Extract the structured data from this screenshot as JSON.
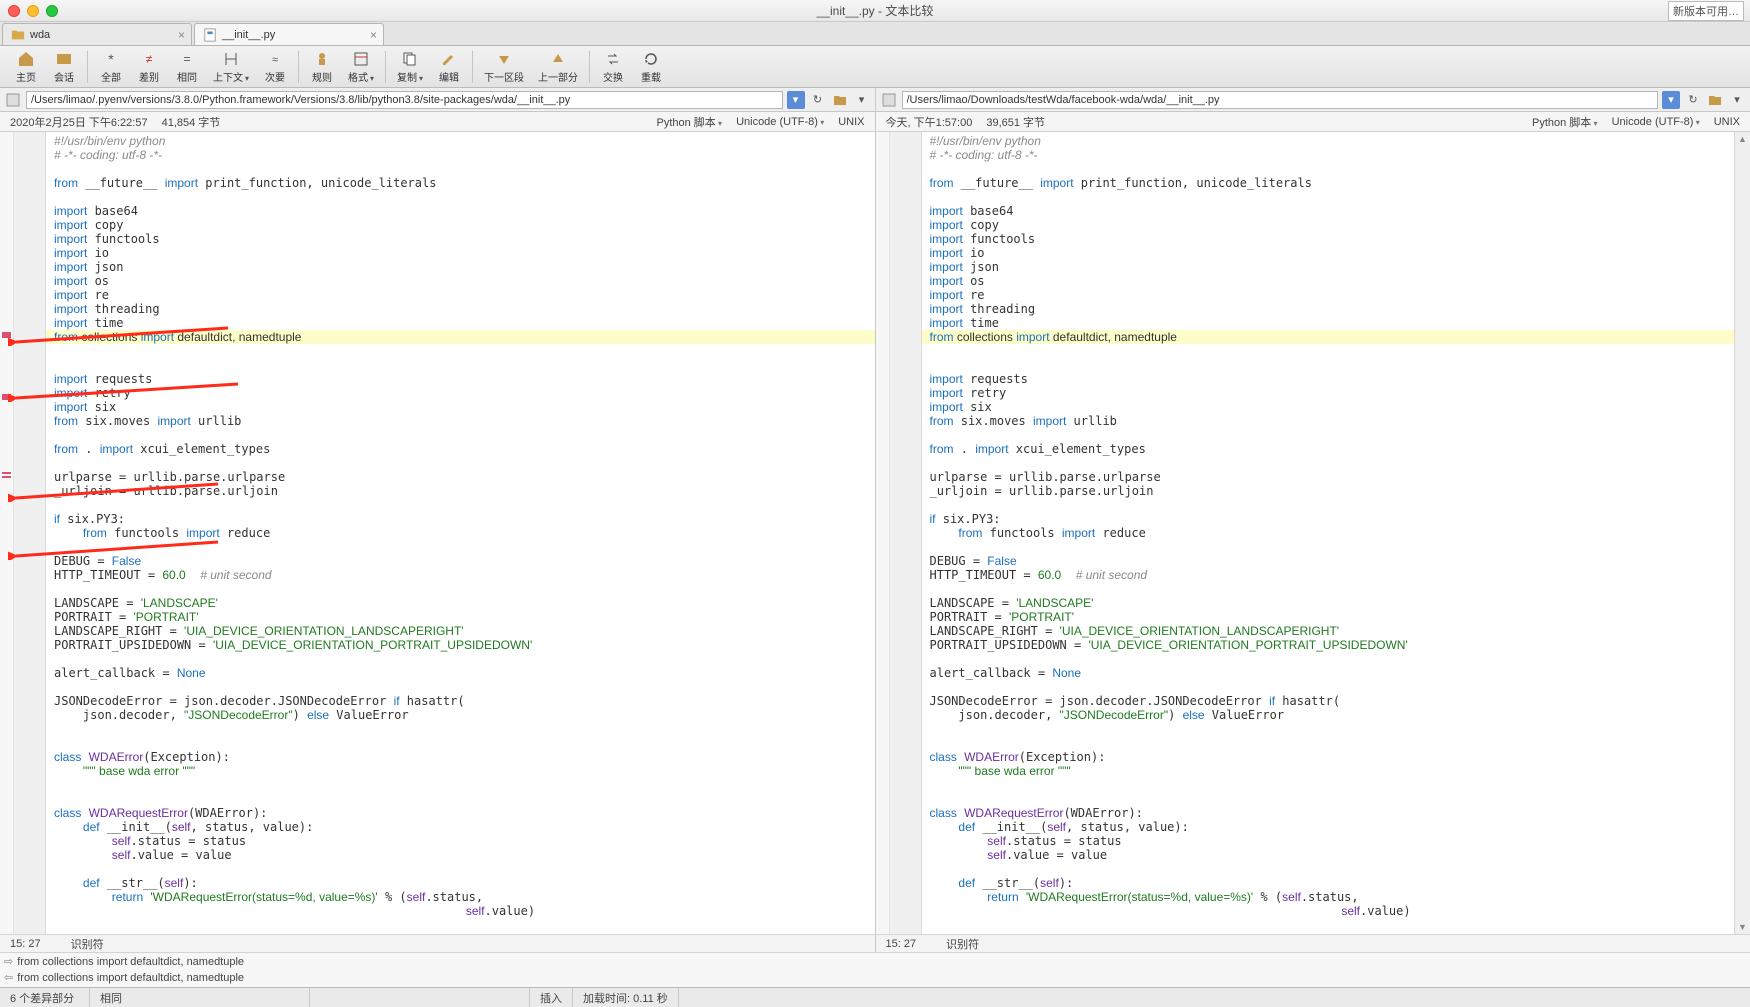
{
  "title": "__init__.py - 文本比较",
  "update_notice": "新版本可用…",
  "tabs": [
    {
      "label": "wda",
      "active": false
    },
    {
      "label": "__init__.py",
      "active": true
    }
  ],
  "toolbar": [
    {
      "id": "home",
      "label": "主页"
    },
    {
      "id": "session",
      "label": "会话"
    },
    {
      "id": "all",
      "label": "全部"
    },
    {
      "id": "diff",
      "label": "差别"
    },
    {
      "id": "same",
      "label": "相同"
    },
    {
      "id": "context",
      "label": "上下文"
    },
    {
      "id": "next",
      "label": "次要"
    },
    {
      "id": "rules",
      "label": "规则"
    },
    {
      "id": "format",
      "label": "格式"
    },
    {
      "id": "copy",
      "label": "复制"
    },
    {
      "id": "edit",
      "label": "编辑"
    },
    {
      "id": "next-diff",
      "label": "下一区段"
    },
    {
      "id": "prev-diff",
      "label": "上一部分"
    },
    {
      "id": "swap",
      "label": "交换"
    },
    {
      "id": "reload",
      "label": "重载"
    }
  ],
  "left": {
    "path": "/Users/limao/.pyenv/versions/3.8.0/Python.framework/Versions/3.8/lib/python3.8/site-packages/wda/__init__.py",
    "meta": {
      "date": "2020年2月25日  下午6:22:57",
      "size": "41,854 字节",
      "lang": "Python 脚本",
      "enc": "Unicode (UTF-8)",
      "eol": "UNIX"
    },
    "cursor": {
      "pos": "15: 27",
      "token": "识别符"
    }
  },
  "right": {
    "path": "/Users/limao/Downloads/testWda/facebook-wda/wda/__init__.py",
    "meta": {
      "date": "今天, 下午1:57:00",
      "size": "39,651 字节",
      "lang": "Python 脚本",
      "enc": "Unicode (UTF-8)",
      "eol": "UNIX"
    },
    "cursor": {
      "pos": "15: 27",
      "token": "识别符"
    }
  },
  "diff_summary": {
    "line_a": "from collections import defaultdict, namedtuple",
    "line_b": "from collections import defaultdict, namedtuple"
  },
  "status": {
    "diff_count": "6 个差异部分",
    "mode": "相同",
    "insert": "插入",
    "load": "加载时间: 0.11 秒"
  },
  "code": {
    "lines": [
      {
        "t": "#!/usr/bin/env python",
        "cls": "c-cm"
      },
      {
        "t": "# -*- coding: utf-8 -*-",
        "cls": "c-cm"
      },
      {
        "t": ""
      },
      {
        "t": "from __future__ import print_function, unicode_literals",
        "kw": [
          "from",
          "import"
        ]
      },
      {
        "t": ""
      },
      {
        "t": "import base64",
        "kw": [
          "import"
        ]
      },
      {
        "t": "import copy",
        "kw": [
          "import"
        ]
      },
      {
        "t": "import functools",
        "kw": [
          "import"
        ]
      },
      {
        "t": "import io",
        "kw": [
          "import"
        ]
      },
      {
        "t": "import json",
        "kw": [
          "import"
        ]
      },
      {
        "t": "import os",
        "kw": [
          "import"
        ]
      },
      {
        "t": "import re",
        "kw": [
          "import"
        ]
      },
      {
        "t": "import threading",
        "kw": [
          "import"
        ]
      },
      {
        "t": "import time",
        "kw": [
          "import"
        ]
      },
      {
        "t": "from collections import defaultdict, namedtuple",
        "kw": [
          "from",
          "import"
        ],
        "hl": true
      },
      {
        "t": ""
      },
      {
        "t": "import requests",
        "kw": [
          "import"
        ]
      },
      {
        "t": "import retry",
        "kw": [
          "import"
        ]
      },
      {
        "t": "import six",
        "kw": [
          "import"
        ]
      },
      {
        "t": "from six.moves import urllib",
        "kw": [
          "from",
          "import"
        ]
      },
      {
        "t": ""
      },
      {
        "t": "from . import xcui_element_types",
        "kw": [
          "from",
          "import"
        ]
      },
      {
        "t": ""
      },
      {
        "t": "urlparse = urllib.parse.urlparse"
      },
      {
        "t": "_urljoin = urllib.parse.urljoin"
      },
      {
        "t": ""
      },
      {
        "t": "if six.PY3:",
        "kw": [
          "if"
        ]
      },
      {
        "t": "    from functools import reduce",
        "kw": [
          "from",
          "import"
        ]
      },
      {
        "t": ""
      },
      {
        "t": "DEBUG = False",
        "kw": [
          "False"
        ]
      },
      {
        "t": "HTTP_TIMEOUT = 60.0  # unit second",
        "num": "60.0",
        "cm": "# unit second"
      },
      {
        "t": ""
      },
      {
        "t": "LANDSCAPE = 'LANDSCAPE'",
        "str": "'LANDSCAPE'"
      },
      {
        "t": "PORTRAIT = 'PORTRAIT'",
        "str": "'PORTRAIT'"
      },
      {
        "t": "LANDSCAPE_RIGHT = 'UIA_DEVICE_ORIENTATION_LANDSCAPERIGHT'",
        "str": "'UIA_DEVICE_ORIENTATION_LANDSCAPERIGHT'"
      },
      {
        "t": "PORTRAIT_UPSIDEDOWN = 'UIA_DEVICE_ORIENTATION_PORTRAIT_UPSIDEDOWN'",
        "str": "'UIA_DEVICE_ORIENTATION_PORTRAIT_UPSIDEDOWN'"
      },
      {
        "t": ""
      },
      {
        "t": "alert_callback = None",
        "kw": [
          "None"
        ]
      },
      {
        "t": ""
      },
      {
        "t": "JSONDecodeError = json.decoder.JSONDecodeError if hasattr(",
        "kw": [
          "if"
        ]
      },
      {
        "t": "    json.decoder, \"JSONDecodeError\") else ValueError",
        "str": "\"JSONDecodeError\"",
        "kw": [
          "else"
        ]
      },
      {
        "t": ""
      },
      {
        "t": ""
      },
      {
        "t": "class WDAError(Exception):",
        "kw": [
          "class"
        ],
        "cls2": "WDAError"
      },
      {
        "t": "    \"\"\" base wda error \"\"\"",
        "str": "\"\"\" base wda error \"\"\""
      },
      {
        "t": ""
      },
      {
        "t": ""
      },
      {
        "t": "class WDARequestError(WDAError):",
        "kw": [
          "class"
        ],
        "cls2": "WDARequestError"
      },
      {
        "t": "    def __init__(self, status, value):",
        "kw": [
          "def"
        ],
        "self": true
      },
      {
        "t": "        self.status = status",
        "self": true
      },
      {
        "t": "        self.value = value",
        "self": true
      },
      {
        "t": ""
      },
      {
        "t": "    def __str__(self):",
        "kw": [
          "def"
        ],
        "self": true
      },
      {
        "t": "        return 'WDARequestError(status=%d, value=%s)' % (self.status,",
        "kw": [
          "return"
        ],
        "str": "'WDARequestError(status=%d, value=%s)'",
        "self": true
      },
      {
        "t": "                                                         self.value)",
        "self": true
      }
    ]
  }
}
